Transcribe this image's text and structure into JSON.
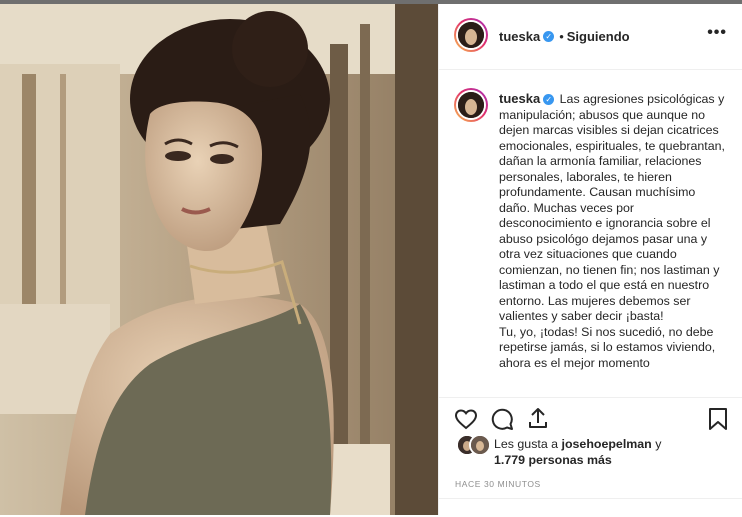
{
  "post": {
    "username": "tueska",
    "verified_icon": "verified-badge-icon",
    "separator": "•",
    "follow_status": "Siguiendo",
    "more_label": "•••",
    "caption_username": "tueska",
    "caption": "Las agresiones psicológicas y manipulación; abusos que aunque no dejen marcas visibles si dejan cicatrices emocionales, espirituales, te quebrantan, dañan la armonía familiar, relaciones personales, laborales, te hieren profundamente. Causan muchísimo daño. Muchas veces por desconocimiento e ignorancia sobre el abuso psicológo dejamos pasar una y otra vez situaciones que cuando comienzan, no tienen fin; nos lastiman y lastiman a todo el que está en nuestro entorno. Las mujeres debemos ser valientes y saber decir ¡basta!",
    "caption_2": "Tu, yo, ¡todas! Si nos sucedió, no debe repetirse jamás, si lo estamos viviendo, ahora es el mejor momento"
  },
  "actions": {
    "like_icon": "heart-icon",
    "comment_icon": "comment-icon",
    "share_icon": "share-icon",
    "save_icon": "bookmark-icon"
  },
  "likes": {
    "prefix": "Les gusta a",
    "user": "josehoepelman",
    "conj": "y",
    "count": "1.779 personas más"
  },
  "timestamp": "HACE 30 MINUTOS",
  "colors": {
    "accent": "#3897f0",
    "text": "#262626",
    "muted": "#8e8e8e",
    "border": "#efefef"
  }
}
